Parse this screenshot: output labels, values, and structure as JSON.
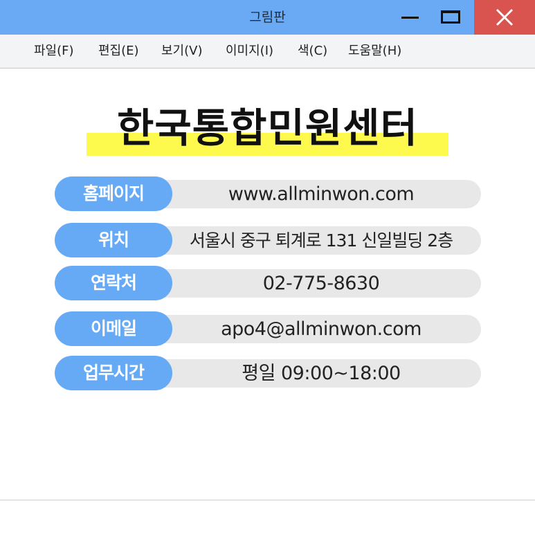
{
  "window": {
    "title": "그림판",
    "colors": {
      "titlebar": "#6aaaf5",
      "close_button": "#d9534f",
      "label_pill": "#66aaf6",
      "value_bar": "#e8e8e8",
      "title_highlight": "#fdfa4d"
    },
    "controls": {
      "minimize_icon": "minimize-icon",
      "maximize_icon": "maximize-icon",
      "close_icon": "close-icon"
    }
  },
  "menu": {
    "items": [
      {
        "label": "파일(F)"
      },
      {
        "label": "편집(E)"
      },
      {
        "label": "보기(V)"
      },
      {
        "label": "이미지(I)"
      },
      {
        "label": "색(C)"
      },
      {
        "label": "도움말(H)"
      }
    ]
  },
  "canvas": {
    "title": "한국통합민원센터",
    "rows": [
      {
        "label": "홈페이지",
        "value": "www.allminwon.com"
      },
      {
        "label": "위치",
        "value": "서울시 중구 퇴계로 131 신일빌딩 2층"
      },
      {
        "label": "연락처",
        "value": "02-775-8630"
      },
      {
        "label": "이메일",
        "value": "apo4@allminwon.com"
      },
      {
        "label": "업무시간",
        "value": "평일 09:00~18:00"
      }
    ]
  }
}
